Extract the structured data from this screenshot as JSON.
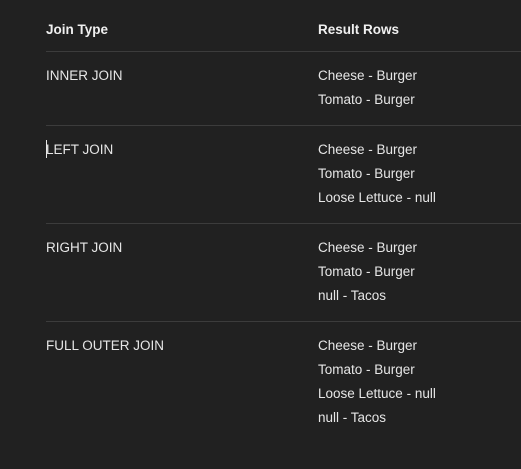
{
  "table": {
    "headers": {
      "join_type": "Join Type",
      "result_rows": "Result Rows"
    },
    "rows": [
      {
        "join_type": "INNER JOIN",
        "results": [
          "Cheese - Burger",
          "Tomato - Burger"
        ]
      },
      {
        "join_type": "LEFT JOIN",
        "results": [
          "Cheese - Burger",
          "Tomato - Burger",
          "Loose Lettuce - null"
        ]
      },
      {
        "join_type": "RIGHT JOIN",
        "results": [
          "Cheese - Burger",
          "Tomato - Burger",
          "null - Tacos"
        ]
      },
      {
        "join_type": "FULL OUTER JOIN",
        "results": [
          "Cheese - Burger",
          "Tomato - Burger",
          "Loose Lettuce - null",
          "null - Tacos"
        ]
      }
    ]
  },
  "colors": {
    "background": "#212121",
    "text": "#e6e6e6",
    "divider": "#3c3c3c"
  }
}
